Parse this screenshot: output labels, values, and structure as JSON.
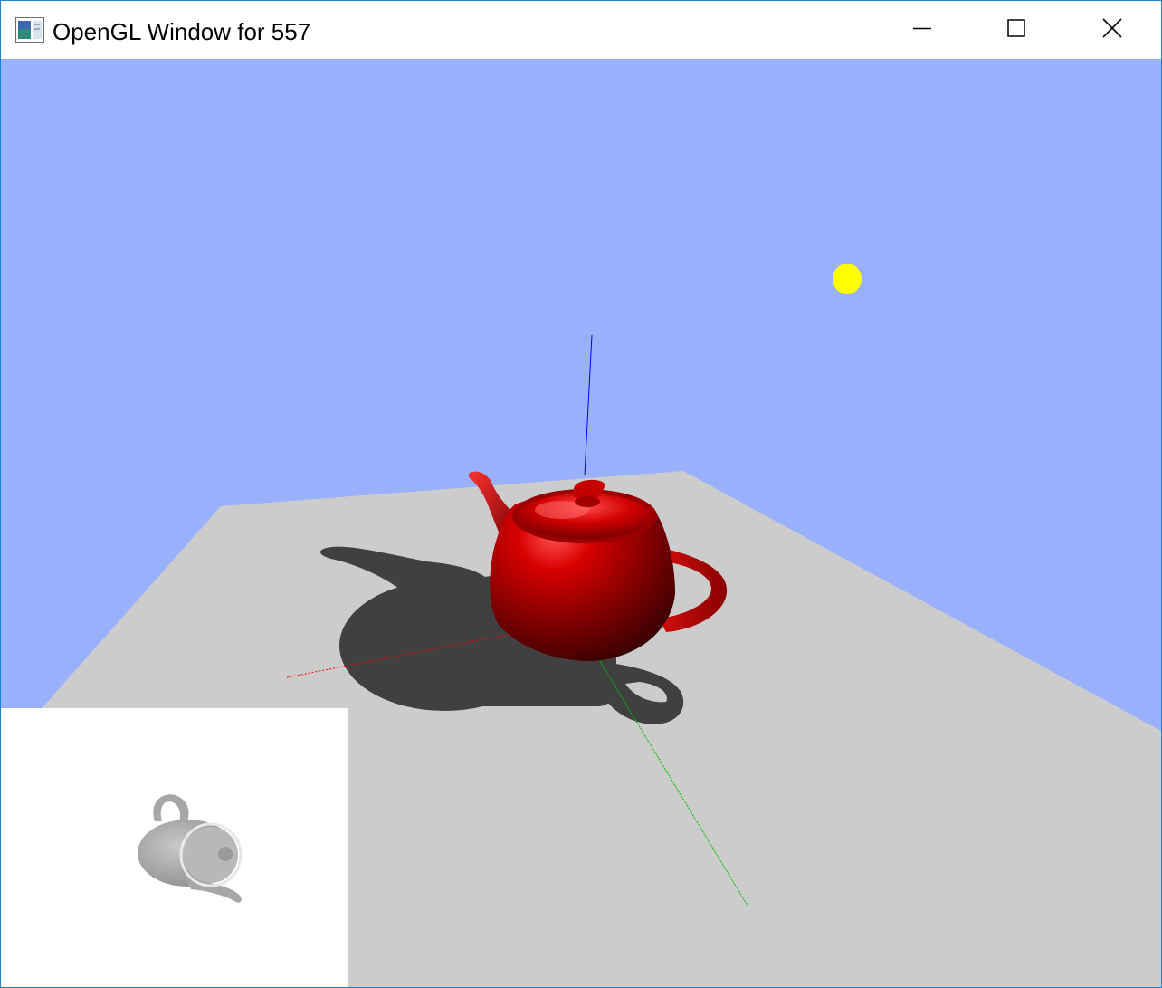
{
  "window": {
    "title": "OpenGL Window for 557",
    "icon": "app-window-icon",
    "controls": {
      "minimize_icon": "minimize-icon",
      "maximize_icon": "maximize-icon",
      "close_icon": "close-icon"
    }
  },
  "scene": {
    "sky_color": "#99b0fc",
    "floor_color": "#cccccc",
    "shadow_color": "#404040",
    "teapot_color": "#c00000",
    "light_color": "#ffff00",
    "axes": {
      "x_color": "#ff0000",
      "y_color": "#00c000",
      "z_color": "#0000ff"
    }
  },
  "shadow_map_panel": {
    "background": "#ffffff",
    "teapot_color": "#a0a0a0"
  }
}
